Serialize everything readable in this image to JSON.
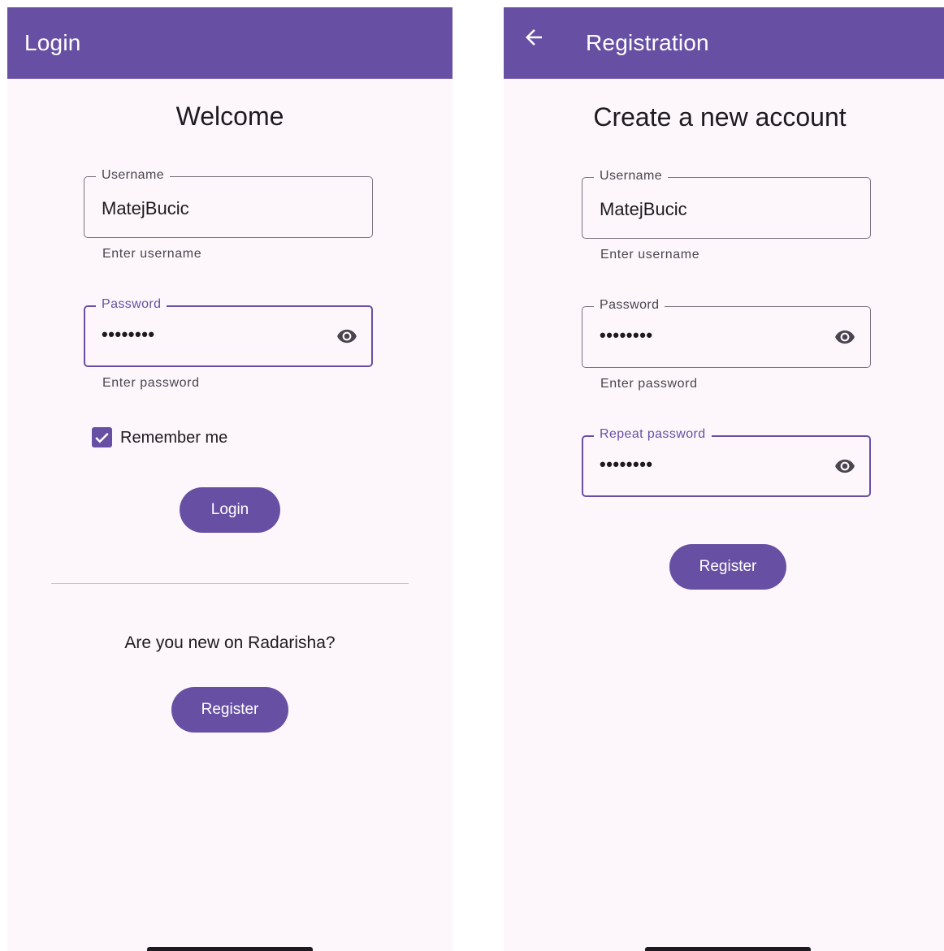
{
  "login_screen": {
    "appbar_title": "Login",
    "heading": "Welcome",
    "username": {
      "label": "Username",
      "value": "MatejBucic",
      "helper": "Enter username"
    },
    "password": {
      "label": "Password",
      "value": "••••••••",
      "helper": "Enter password"
    },
    "remember_me": {
      "label": "Remember me",
      "checked": true
    },
    "login_button": "Login",
    "new_user_prompt": "Are you new on Radarisha?",
    "register_button": "Register"
  },
  "register_screen": {
    "appbar_title": "Registration",
    "heading": "Create a new account",
    "username": {
      "label": "Username",
      "value": "MatejBucic",
      "helper": "Enter username"
    },
    "password": {
      "label": "Password",
      "value": "••••••••",
      "helper": "Enter password"
    },
    "repeat_password": {
      "label": "Repeat password",
      "value": "••••••••"
    },
    "register_button": "Register"
  },
  "colors": {
    "primary": "#6750a4",
    "surface": "#fdf7fb",
    "on_surface": "#1d1b20",
    "outline": "#79747e"
  }
}
